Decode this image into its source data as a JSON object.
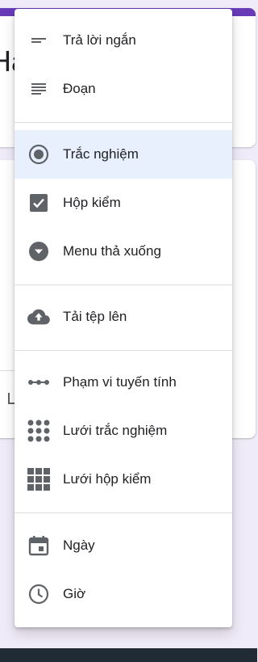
{
  "background": {
    "form_title_fragment": "Ha"
  },
  "colors": {
    "accent": "#673ab7",
    "selected_bg": "#e8f0fe",
    "icon": "#5f6368",
    "text": "#202124"
  },
  "menu": {
    "items": [
      {
        "label": "Trả lời ngắn",
        "icon": "short-answer-icon"
      },
      {
        "label": "Đoạn",
        "icon": "paragraph-icon"
      },
      {
        "label": "Trắc nghiệm",
        "icon": "radio-button-icon",
        "selected": true
      },
      {
        "label": "Hộp kiểm",
        "icon": "checkbox-icon"
      },
      {
        "label": "Menu thả xuống",
        "icon": "dropdown-icon"
      },
      {
        "label": "Tải tệp lên",
        "icon": "cloud-upload-icon"
      },
      {
        "label": "Phạm vi tuyến tính",
        "icon": "linear-scale-icon"
      },
      {
        "label": "Lưới trắc nghiệm",
        "icon": "multiple-choice-grid-icon"
      },
      {
        "label": "Lưới hộp kiểm",
        "icon": "checkbox-grid-icon"
      },
      {
        "label": "Ngày",
        "icon": "calendar-icon"
      },
      {
        "label": "Giờ",
        "icon": "clock-icon"
      }
    ]
  }
}
